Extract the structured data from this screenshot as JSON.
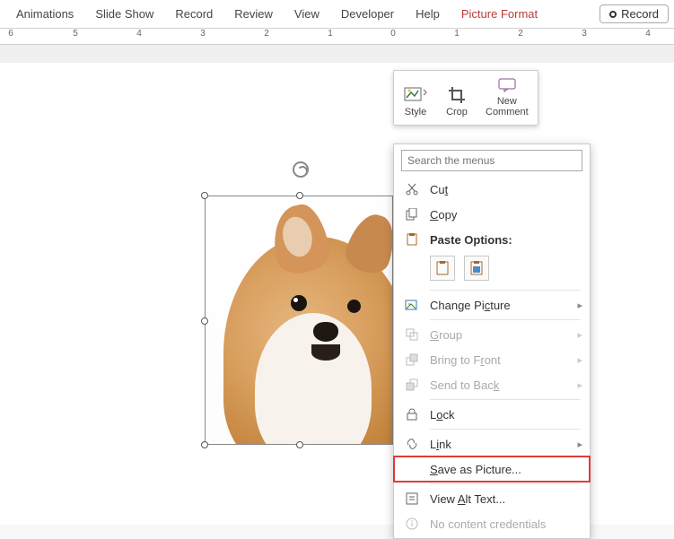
{
  "ribbon_tabs": {
    "animations": "Animations",
    "slideshow": "Slide Show",
    "record": "Record",
    "review": "Review",
    "view": "View",
    "developer": "Developer",
    "help": "Help",
    "picture_format": "Picture Format"
  },
  "record_button": "Record",
  "ruler_labels": [
    "6",
    "5",
    "4",
    "3",
    "2",
    "1",
    "0",
    "1",
    "2",
    "3",
    "4"
  ],
  "mini_toolbar": {
    "style": "Style",
    "crop": "Crop",
    "new_comment_line1": "New",
    "new_comment_line2": "Comment"
  },
  "search": {
    "placeholder": "Search the menus"
  },
  "menu": {
    "cut": "Cut",
    "copy": "Copy",
    "paste_options": "Paste Options:",
    "change_picture": "Change Picture",
    "group": "Group",
    "bring_front": "Bring to Front",
    "send_back": "Send to Back",
    "lock": "Lock",
    "link": "Link",
    "save_as_picture": "Save as Picture...",
    "view_alt": "View Alt Text...",
    "no_credentials": "No content credentials"
  }
}
